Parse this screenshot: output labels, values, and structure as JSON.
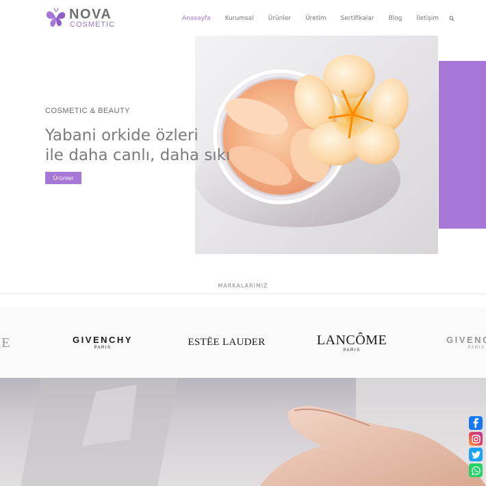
{
  "header": {
    "logo_name": "NOVA",
    "logo_sub": "COSMETIC",
    "nav": [
      {
        "label": "Anasayfa",
        "active": true
      },
      {
        "label": "Kurumsal",
        "active": false
      },
      {
        "label": "Ürünler",
        "active": false
      },
      {
        "label": "Üretim",
        "active": false
      },
      {
        "label": "Sertifikalar",
        "active": false
      },
      {
        "label": "Blog",
        "active": false
      },
      {
        "label": "İletişim",
        "active": false
      }
    ],
    "search_icon": "search-icon"
  },
  "hero": {
    "kicker": "COSMETIC & BEAUTY",
    "title_line1": "Yabani orkide özleri",
    "title_line2": "ile daha canlı, daha sıkı",
    "button_label": "Ürünler"
  },
  "brands": {
    "title": "MARKALARIMIZ",
    "items": [
      {
        "name": "OME",
        "sub": ""
      },
      {
        "name": "GIVENCHY",
        "sub": "PARIS"
      },
      {
        "name": "ESTĒE LAUDER",
        "sub": ""
      },
      {
        "name": "LANCÔME",
        "sub": "PARIS"
      },
      {
        "name": "GIVENCHY",
        "sub": "PARIS"
      }
    ]
  },
  "social": [
    "facebook-icon",
    "instagram-icon",
    "twitter-icon",
    "whatsapp-icon"
  ],
  "colors": {
    "accent": "#a777d8",
    "text": "#7b7b7b",
    "facebook": "#1877f2",
    "whatsapp": "#25d366"
  }
}
